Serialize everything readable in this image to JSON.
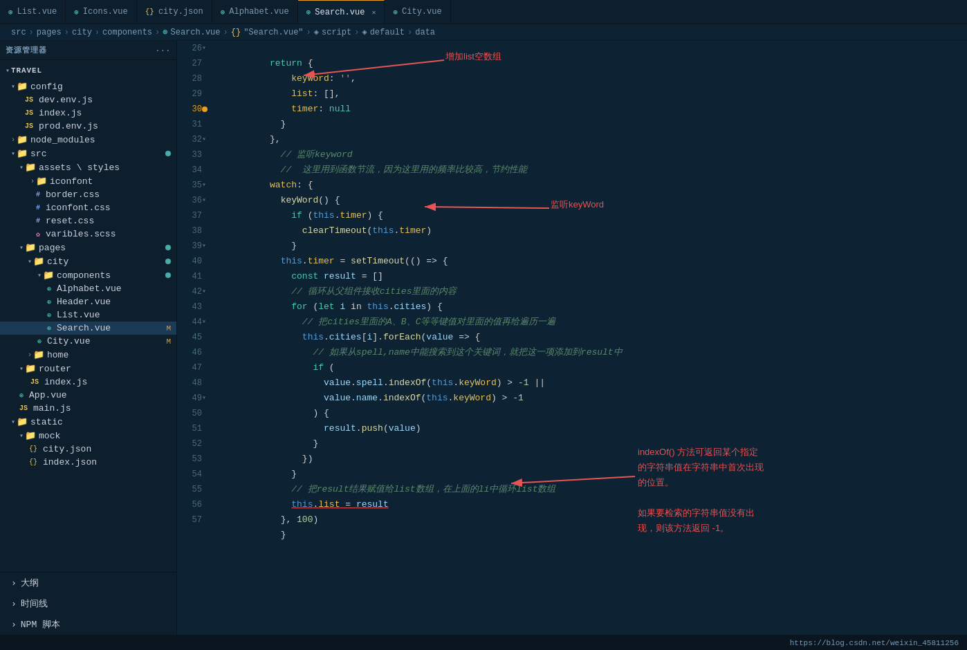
{
  "tabBar": {
    "tabs": [
      {
        "id": "list",
        "label": "List.vue",
        "icon": "vue",
        "active": false,
        "modified": false
      },
      {
        "id": "icons",
        "label": "Icons.vue",
        "icon": "vue",
        "active": false,
        "modified": false
      },
      {
        "id": "city",
        "label": "city.json",
        "icon": "json",
        "active": false,
        "modified": false
      },
      {
        "id": "alphabet",
        "label": "Alphabet.vue",
        "icon": "vue",
        "active": false,
        "modified": false
      },
      {
        "id": "search",
        "label": "Search.vue",
        "icon": "vue",
        "active": true,
        "modified": false,
        "hasClose": true
      },
      {
        "id": "cityvue",
        "label": "City.vue",
        "icon": "vue",
        "active": false,
        "modified": false
      }
    ]
  },
  "breadcrumb": "src > pages > city > components > Search.vue > {} \"Search.vue\" > script > default > data",
  "sidebar": {
    "title": "资源管理器",
    "projectName": "TRAVEL",
    "items": [
      {
        "id": "config",
        "label": "config",
        "type": "folder",
        "indent": 0,
        "expanded": true
      },
      {
        "id": "dev-env",
        "label": "dev.env.js",
        "type": "js",
        "indent": 1
      },
      {
        "id": "index-config",
        "label": "index.js",
        "type": "js",
        "indent": 1
      },
      {
        "id": "prod-env",
        "label": "prod.env.js",
        "type": "js",
        "indent": 1
      },
      {
        "id": "node-modules",
        "label": "node_modules",
        "type": "folder",
        "indent": 0,
        "expanded": false
      },
      {
        "id": "src",
        "label": "src",
        "type": "folder",
        "indent": 0,
        "expanded": true,
        "dot": true
      },
      {
        "id": "assets",
        "label": "assets \\ styles",
        "type": "folder",
        "indent": 1,
        "expanded": true
      },
      {
        "id": "iconfont",
        "label": "iconfont",
        "type": "folder",
        "indent": 2,
        "expanded": false
      },
      {
        "id": "border-css",
        "label": "border.css",
        "type": "css",
        "indent": 2
      },
      {
        "id": "iconfont-css",
        "label": "iconfont.css",
        "type": "css",
        "indent": 2
      },
      {
        "id": "reset-css",
        "label": "reset.css",
        "type": "css",
        "indent": 2
      },
      {
        "id": "varibles-scss",
        "label": "varibles.scss",
        "type": "scss",
        "indent": 2
      },
      {
        "id": "pages",
        "label": "pages",
        "type": "folder",
        "indent": 1,
        "expanded": true,
        "dot": true
      },
      {
        "id": "city",
        "label": "city",
        "type": "folder",
        "indent": 2,
        "expanded": true,
        "dot": true
      },
      {
        "id": "components",
        "label": "components",
        "type": "folder",
        "indent": 3,
        "expanded": true,
        "dot": true
      },
      {
        "id": "alphabet-vue",
        "label": "Alphabet.vue",
        "type": "vue",
        "indent": 4
      },
      {
        "id": "header-vue",
        "label": "Header.vue",
        "type": "vue",
        "indent": 4
      },
      {
        "id": "list-vue",
        "label": "List.vue",
        "type": "vue",
        "indent": 4
      },
      {
        "id": "search-vue",
        "label": "Search.vue",
        "type": "vue",
        "indent": 4,
        "selected": true,
        "badge": "M"
      },
      {
        "id": "city-vue",
        "label": "City.vue",
        "type": "vue",
        "indent": 3,
        "badge": "M"
      },
      {
        "id": "home",
        "label": "home",
        "type": "folder",
        "indent": 2,
        "expanded": false
      },
      {
        "id": "router",
        "label": "router",
        "type": "folder",
        "indent": 1,
        "expanded": true
      },
      {
        "id": "router-index",
        "label": "index.js",
        "type": "js",
        "indent": 2
      },
      {
        "id": "app-vue",
        "label": "App.vue",
        "type": "vue",
        "indent": 1
      },
      {
        "id": "main-js",
        "label": "main.js",
        "type": "js",
        "indent": 1
      },
      {
        "id": "static",
        "label": "static",
        "type": "folder",
        "indent": 0,
        "expanded": true
      },
      {
        "id": "mock",
        "label": "mock",
        "type": "folder",
        "indent": 1,
        "expanded": true
      },
      {
        "id": "city-json",
        "label": "city.json",
        "type": "json",
        "indent": 2
      },
      {
        "id": "index-json",
        "label": "index.json",
        "type": "json",
        "indent": 2
      }
    ],
    "bottomItems": [
      {
        "id": "outline",
        "label": "大纲"
      },
      {
        "id": "timeline",
        "label": "时间线"
      },
      {
        "id": "npm",
        "label": "NPM 脚本"
      }
    ]
  },
  "code": {
    "lines": [
      {
        "num": 26,
        "content": "return {"
      },
      {
        "num": 27,
        "content": "  keyWord: '',"
      },
      {
        "num": 28,
        "content": "  list: [],"
      },
      {
        "num": 29,
        "content": "  timer: null"
      },
      {
        "num": 30,
        "content": "}"
      },
      {
        "num": 31,
        "content": "},"
      },
      {
        "num": 32,
        "content": "// 监听keyword"
      },
      {
        "num": 33,
        "content": "// 这里用到函数节流，因为这里用的频率比较高，节约性能"
      },
      {
        "num": 34,
        "content": "watch: {"
      },
      {
        "num": 35,
        "content": "  keyWord() {"
      },
      {
        "num": 36,
        "content": "    if (this.timer) {"
      },
      {
        "num": 37,
        "content": "      clearTimeout(this.timer)"
      },
      {
        "num": 38,
        "content": "    }"
      },
      {
        "num": 39,
        "content": "  this.timer = setTimeout(() => {"
      },
      {
        "num": 40,
        "content": "    const result = []"
      },
      {
        "num": 41,
        "content": "    // 循环从父组件接收cities里面的内容"
      },
      {
        "num": 42,
        "content": "    for (let i in this.cities) {"
      },
      {
        "num": 43,
        "content": "      // 把cities里面的A、B、C等等键值对里面的值再给遍历一遍"
      },
      {
        "num": 44,
        "content": "      this.cities[i].forEach(value => {"
      },
      {
        "num": 45,
        "content": "        // 如果从spell,name中能搜索到这个关键词，就把这一项添加到result中"
      },
      {
        "num": 46,
        "content": "        if ("
      },
      {
        "num": 47,
        "content": "          value.spell.indexOf(this.keyWord) > -1 ||"
      },
      {
        "num": 48,
        "content": "          value.name.indexOf(this.keyWord) > -1"
      },
      {
        "num": 49,
        "content": "        ) {"
      },
      {
        "num": 50,
        "content": "          result.push(value)"
      },
      {
        "num": 51,
        "content": "        }"
      },
      {
        "num": 52,
        "content": "      })"
      },
      {
        "num": 53,
        "content": "    }"
      },
      {
        "num": 54,
        "content": "    // 把result结果赋值给list数组，在上面的li中循环list数组"
      },
      {
        "num": 55,
        "content": "    this.list = result"
      },
      {
        "num": 56,
        "content": "  }, 100)"
      },
      {
        "num": 57,
        "content": "  }"
      }
    ]
  },
  "annotations": {
    "list_empty": "增加list空数组",
    "watch_keyword": "监听keyWord",
    "indexof_desc1": "indexOf() 方法可返回某个指定",
    "indexof_desc2": "的字符串值在字符串中首次出现",
    "indexof_desc3": "的位置。",
    "indexof_desc4": "如果要检索的字符串值没有出",
    "indexof_desc5": "现，则该方法返回 -1。"
  },
  "statusBar": {
    "url": "https://blog.csdn.net/weixin_45811256"
  }
}
